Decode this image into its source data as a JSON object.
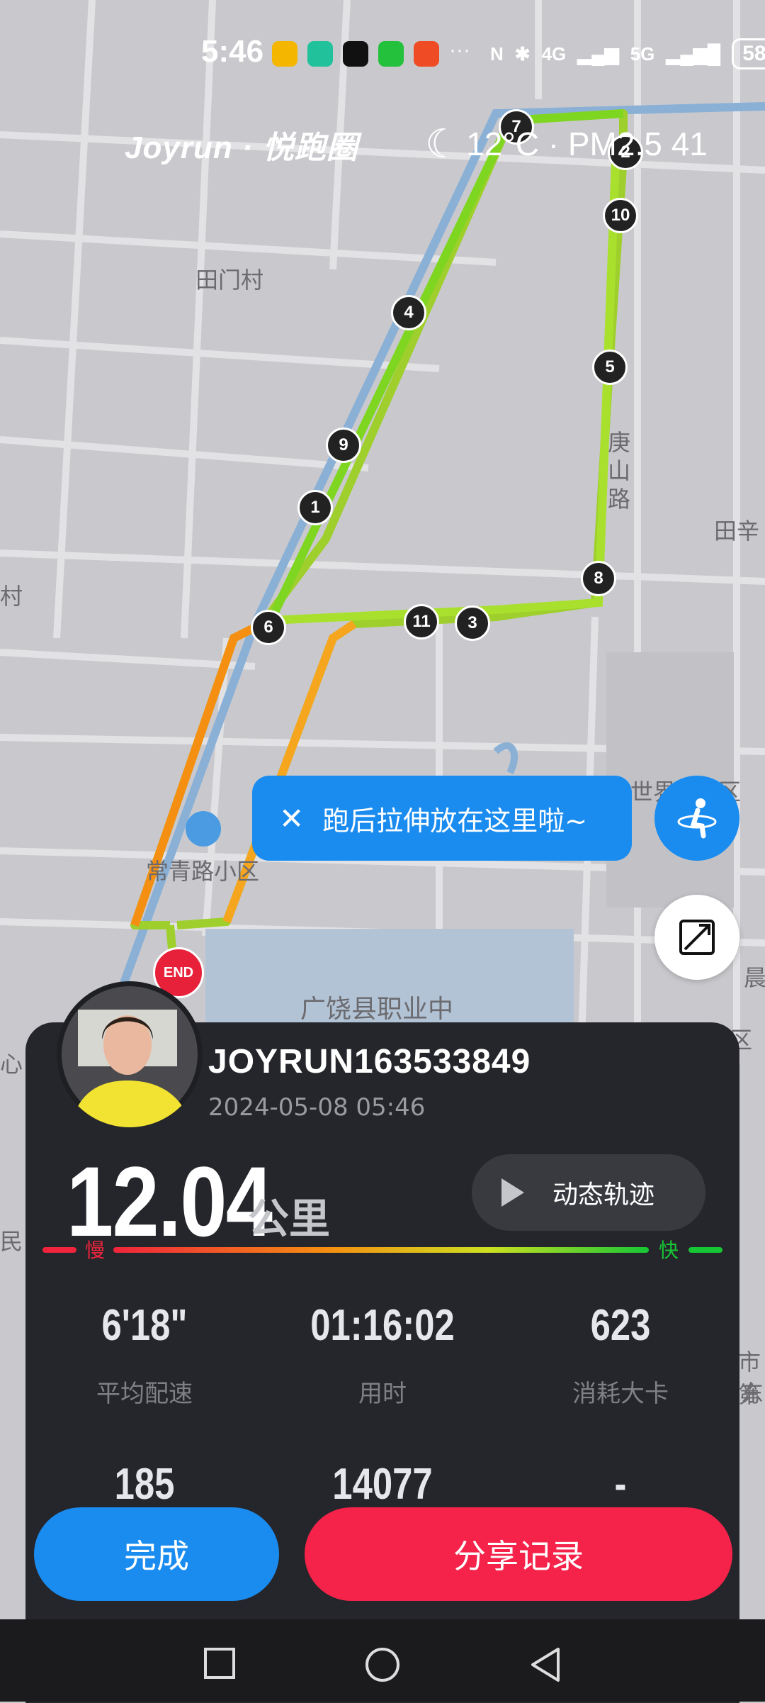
{
  "status_bar": {
    "time": "5:46",
    "network_1": "4G",
    "network_2": "5G",
    "battery": "58"
  },
  "app": {
    "brand": "Joyrun · 悦跑圈"
  },
  "weather": {
    "text": "12°C · PM2.5 41"
  },
  "map_labels": {
    "village_1": "田门村",
    "village_2": "田辛",
    "village_3": "村",
    "road_1": "庚山路",
    "community": "常青路小区",
    "school": "广饶县职业中",
    "left_1": "心",
    "left_2": "民",
    "right_1": "晨",
    "right_2": "区",
    "right_3": "市第",
    "right_4": "东",
    "world": "世界",
    "world_area": "区"
  },
  "route": {
    "km_markers": [
      "1",
      "2",
      "3",
      "4",
      "5",
      "6",
      "7",
      "8",
      "9",
      "10",
      "11"
    ],
    "end_label": "END"
  },
  "tooltip": {
    "text": "跑后拉伸放在这里啦~"
  },
  "summary": {
    "username": "JOYRUN163533849",
    "datetime": "2024-05-08 05:46",
    "distance": "12.04",
    "distance_unit": "公里",
    "replay_label": "动态轨迹",
    "pace_slow": "慢",
    "pace_fast": "快",
    "stats": [
      {
        "value": "6'18\"",
        "label": "平均配速"
      },
      {
        "value": "01:16:02",
        "label": "用时"
      },
      {
        "value": "623",
        "label": "消耗大卡"
      },
      {
        "value": "185",
        "label": ""
      },
      {
        "value": "14077",
        "label": ""
      },
      {
        "value": "-",
        "label": ""
      }
    ]
  },
  "actions": {
    "done": "完成",
    "share": "分享记录"
  },
  "colors": {
    "accent_blue": "#1a8cf0",
    "share_red": "#f5234a",
    "panel_bg": "#25262b"
  }
}
